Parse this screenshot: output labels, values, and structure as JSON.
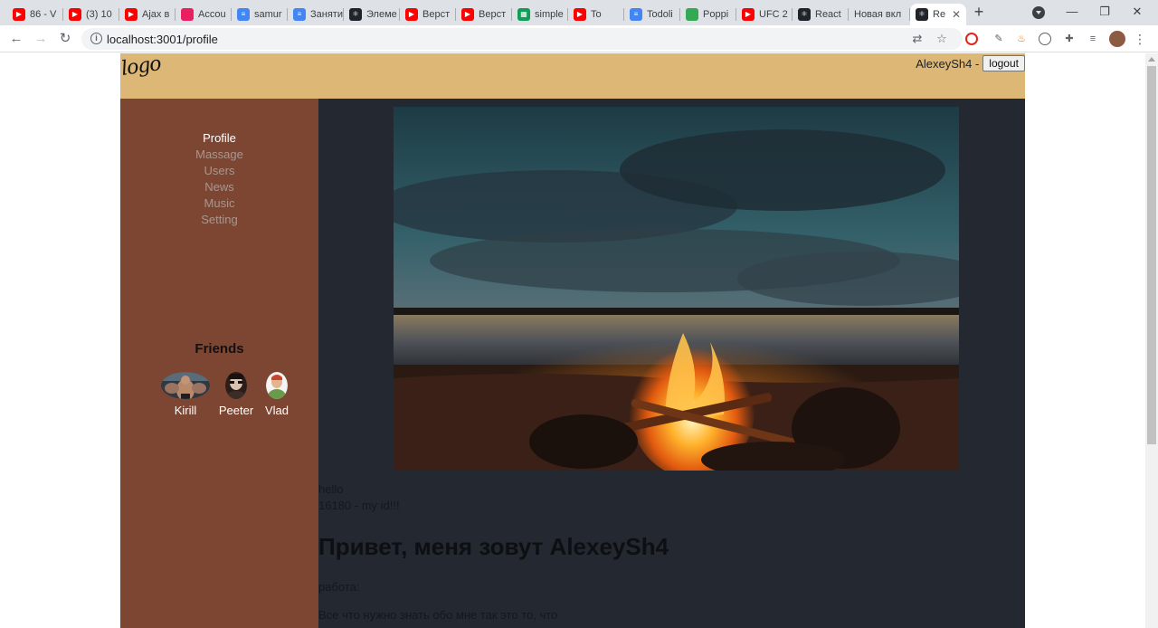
{
  "browser": {
    "tabs": [
      {
        "label": "86 - V",
        "icon": "youtube-icon",
        "color": "#ff0000"
      },
      {
        "label": "(3) 10",
        "icon": "youtube-icon",
        "color": "#ff0000"
      },
      {
        "label": "Ajax в",
        "icon": "youtube-icon",
        "color": "#ff0000"
      },
      {
        "label": "Accou",
        "icon": "pink-circle-icon",
        "color": "#e91e63"
      },
      {
        "label": "samur",
        "icon": "docs-icon",
        "color": "#4285f4"
      },
      {
        "label": "Заняти",
        "icon": "docs-icon",
        "color": "#4285f4"
      },
      {
        "label": "Элеме",
        "icon": "react-icon",
        "color": "#20232a"
      },
      {
        "label": "Верст",
        "icon": "youtube-icon",
        "color": "#ff0000"
      },
      {
        "label": "Верст",
        "icon": "youtube-icon",
        "color": "#ff0000"
      },
      {
        "label": "simple",
        "icon": "sheets-icon",
        "color": "#0f9d58"
      },
      {
        "label": "To",
        "icon": "youtube-icon",
        "color": "#ff0000"
      },
      {
        "label": "Todoli",
        "icon": "docs-icon",
        "color": "#4285f4"
      },
      {
        "label": "Poppi",
        "icon": "poppins-icon",
        "color": "#34a853"
      },
      {
        "label": "UFC 2",
        "icon": "youtube-icon",
        "color": "#ff0000"
      },
      {
        "label": "React",
        "icon": "react-icon",
        "color": "#20232a"
      },
      {
        "label": "Новая вкл",
        "icon": "",
        "color": ""
      },
      {
        "label": "Re",
        "icon": "react-icon",
        "color": "#20232a"
      }
    ],
    "active_tab": 16,
    "new_tab_label": "+",
    "close_label": "✕",
    "url": "localhost:3001/profile"
  },
  "header": {
    "logo_text": "logo",
    "login_name": "AlexeySh4 -",
    "logout_label": "logout"
  },
  "nav": {
    "items": [
      "Profile",
      "Massage",
      "Users",
      "News",
      "Music",
      "Setting"
    ],
    "active": 0
  },
  "friends": {
    "title": "Friends",
    "list": [
      "Kirill",
      "Peeter",
      "Vlad"
    ]
  },
  "profile": {
    "status": "hello",
    "id_line": "16180 - my id!!!",
    "heading": "Привет, меня зовут AlexeySh4",
    "job": "работа:",
    "about": "Все что нужно знать обо мне так это то, что"
  }
}
